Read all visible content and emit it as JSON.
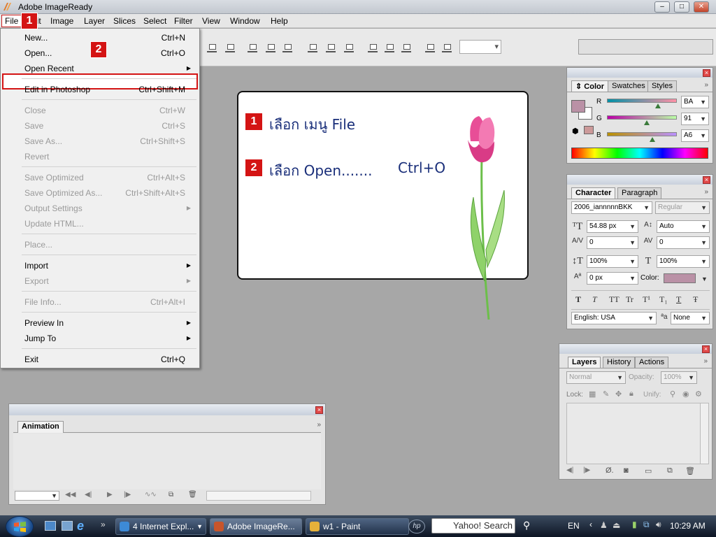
{
  "window": {
    "title": "Adobe ImageReady",
    "controls": {
      "minimize": "–",
      "maximize": "□",
      "close": "✕"
    }
  },
  "menubar": {
    "items": [
      "File",
      "Edit",
      "Image",
      "Layer",
      "Slices",
      "Select",
      "Filter",
      "View",
      "Window",
      "Help"
    ]
  },
  "annotations": {
    "badge_1": "1",
    "badge_2": "2"
  },
  "file_menu": {
    "items": [
      {
        "label": "New...",
        "shortcut": "Ctrl+N",
        "enabled": true
      },
      {
        "label": "Open...",
        "shortcut": "Ctrl+O",
        "enabled": true,
        "highlighted": true
      },
      {
        "label": "Open Recent",
        "submenu": true,
        "enabled": true
      },
      {
        "label": "Edit in Photoshop",
        "shortcut": "Ctrl+Shift+M",
        "enabled": true
      },
      {
        "label": "Close",
        "shortcut": "Ctrl+W",
        "enabled": false
      },
      {
        "label": "Save",
        "shortcut": "Ctrl+S",
        "enabled": false
      },
      {
        "label": "Save As...",
        "shortcut": "Ctrl+Shift+S",
        "enabled": false
      },
      {
        "label": "Revert",
        "enabled": false
      },
      {
        "label": "Save Optimized",
        "shortcut": "Ctrl+Alt+S",
        "enabled": false
      },
      {
        "label": "Save Optimized As...",
        "shortcut": "Ctrl+Shift+Alt+S",
        "enabled": false
      },
      {
        "label": "Output Settings",
        "submenu": true,
        "enabled": false
      },
      {
        "label": "Update HTML...",
        "enabled": false
      },
      {
        "label": "Place...",
        "enabled": false
      },
      {
        "label": "Import",
        "submenu": true,
        "enabled": true
      },
      {
        "label": "Export",
        "submenu": true,
        "enabled": false
      },
      {
        "label": "File Info...",
        "shortcut": "Ctrl+Alt+I",
        "enabled": false
      },
      {
        "label": "Preview In",
        "submenu": true,
        "enabled": true
      },
      {
        "label": "Jump To",
        "submenu": true,
        "enabled": true
      },
      {
        "label": "Exit",
        "shortcut": "Ctrl+Q",
        "enabled": true
      }
    ]
  },
  "document": {
    "step1": {
      "num": "1",
      "text": "เลือก เมนู File"
    },
    "step2": {
      "num": "2",
      "text": "เลือก Open.......",
      "shortcut": "Ctrl+O"
    }
  },
  "color_palette": {
    "tabs": [
      "Color",
      "Swatches",
      "Styles"
    ],
    "active_tab": "Color",
    "channels": [
      {
        "label": "R",
        "value": "BA",
        "level": 0.73
      },
      {
        "label": "G",
        "value": "91",
        "level": 0.57
      },
      {
        "label": "B",
        "value": "A6",
        "level": 0.65
      }
    ],
    "foreground_color": "#BA91A6",
    "background_color": "#FFFFFF",
    "web_color": "#CC9999"
  },
  "character_palette": {
    "tabs": [
      "Character",
      "Paragraph"
    ],
    "active_tab": "Character",
    "font_family": "2006_iannnnnBKK",
    "font_style": "Regular",
    "font_size": "54.88 px",
    "leading": "Auto",
    "kerning": "0",
    "tracking": "0",
    "vertical_scale": "100%",
    "horizontal_scale": "100%",
    "baseline_shift": "0 px",
    "color_label": "Color:",
    "text_color": "#BA91A6",
    "style_buttons": [
      "T",
      "T",
      "TT",
      "Tr",
      "T¹",
      "T₁",
      "T",
      "Ŧ"
    ],
    "language": "English: USA",
    "antialias_icon": "ªa",
    "antialias": "None"
  },
  "layers_palette": {
    "tabs": [
      "Layers",
      "History",
      "Actions"
    ],
    "active_tab": "Layers",
    "blend_mode": "Normal",
    "opacity_label": "Opacity:",
    "opacity": "100%",
    "lock_label": "Lock:",
    "unify_label": "Unify:"
  },
  "animation_palette": {
    "tabs": [
      "Animation"
    ]
  },
  "taskbar": {
    "buttons": [
      {
        "label": "4 Internet Expl...",
        "icon": "ie-icon",
        "color": "#3d8ad6"
      },
      {
        "label": "Adobe ImageRe...",
        "icon": "imageready-icon",
        "color": "#c8552b",
        "active": true
      },
      {
        "label": "w1 - Paint",
        "icon": "paint-icon",
        "color": "#e5b13a"
      }
    ],
    "search_placeholder": "Yahoo! Search",
    "language": "EN",
    "time": "10:29 AM"
  }
}
